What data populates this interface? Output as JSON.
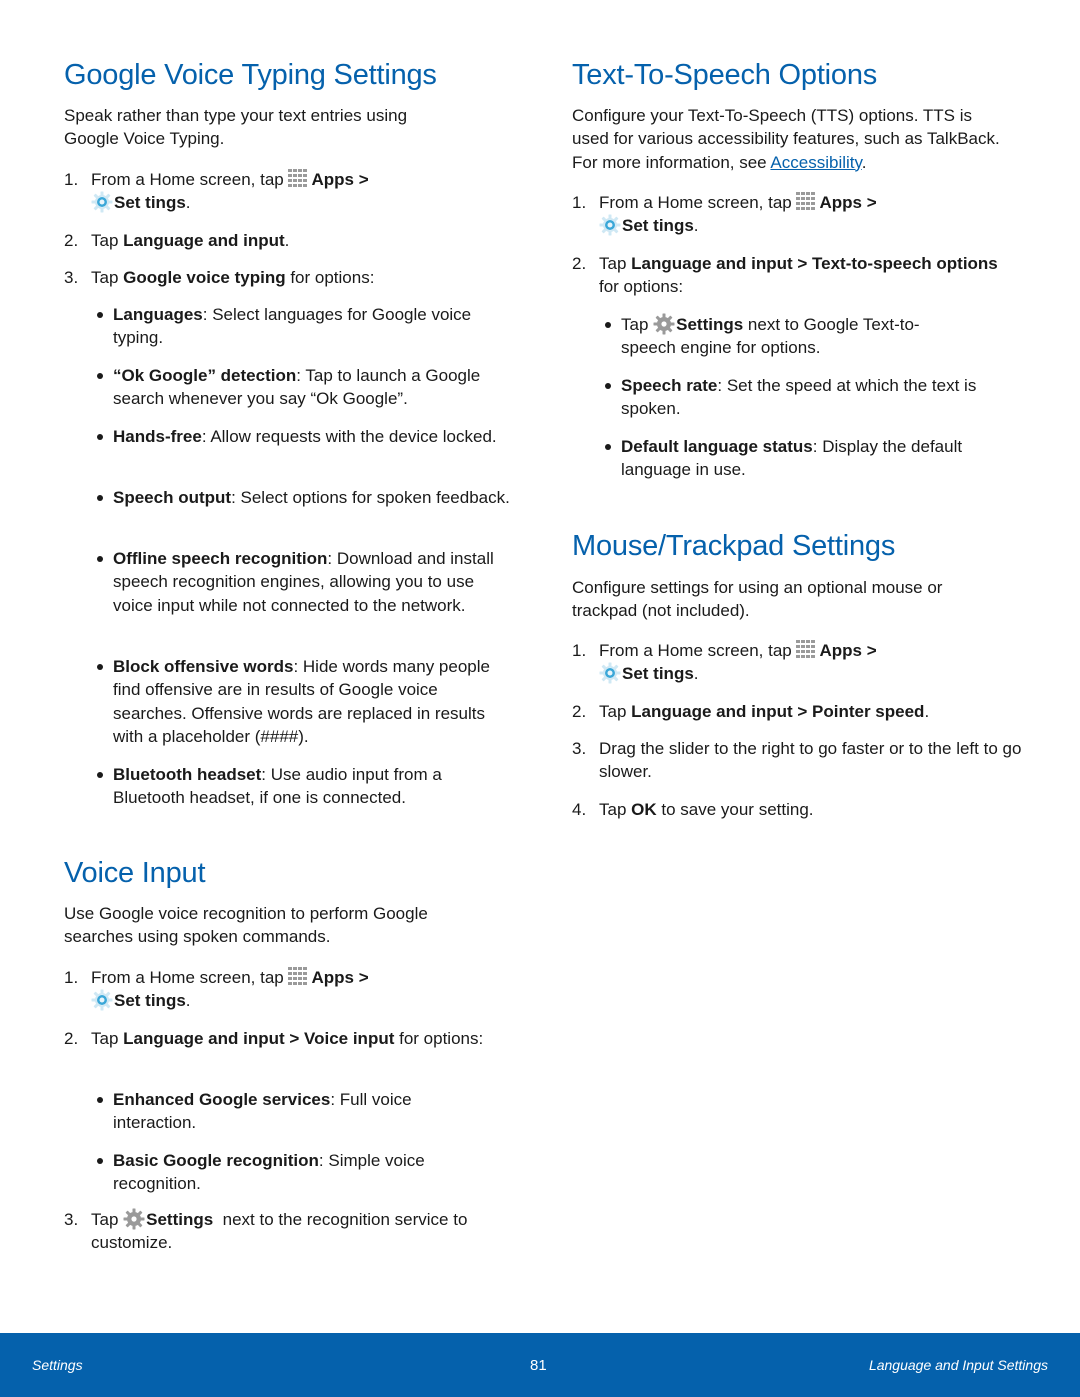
{
  "left": {
    "gvt": {
      "title": "Google Voice Typing Settings",
      "intro": "Speak rather than type your text entries using Google Voice Typing.",
      "step1": {
        "num": "1.",
        "pre": "From a Home screen, tap ",
        "apps": "Apps",
        "sep": " >",
        "settings": "Set tings",
        "end": "."
      },
      "step2": {
        "num": "2.",
        "pre": "Tap ",
        "bold": "Language and input",
        "end": "."
      },
      "step3": {
        "num": "3.",
        "pre": "Tap ",
        "bold": "Google voice typing",
        "end": " for options:"
      },
      "bullets": [
        {
          "term": "Languages",
          "text": ": Select languages for Google voice typing."
        },
        {
          "term": "“Ok Google” detection",
          "text": ": Tap to launch a Google search whenever you say “Ok Google”."
        },
        {
          "term": "Hands-free",
          "text": ": Allow requests with the device locked."
        },
        {
          "term": "Speech output",
          "text": ": Select options for spoken feedback."
        },
        {
          "term": "Offline speech recognition",
          "text": ": Download and install speech recognition engines, allowing you to use voice input while not connected to the network."
        },
        {
          "term": "Block offensive words",
          "text": ": Hide words many people find offensive are in results of Google voice searches. Offensive words are replaced in results with a placeholder (####)."
        },
        {
          "term": "Bluetooth headset",
          "text": ": Use audio input from a Bluetooth headset, if one is connected."
        }
      ]
    },
    "voice": {
      "title": "Voice Input",
      "intro": "Use Google voice recognition to perform Google searches using spoken commands.",
      "step1": {
        "num": "1.",
        "pre": "From a Home screen, tap ",
        "apps": "Apps",
        "sep": " >",
        "settings": "Set tings",
        "end": "."
      },
      "step2": {
        "num": "2.",
        "pre": "Tap ",
        "bold1": "Language and input",
        "mid": " > ",
        "bold2": "Voice input",
        "end": " for options:"
      },
      "bullets": [
        {
          "term": "Enhanced Google services",
          "text": ": Full voice interaction."
        },
        {
          "term": "Basic Google recognition",
          "text": ": Simple voice recognition."
        }
      ],
      "step3": {
        "num": "3.",
        "pre": "Tap ",
        "bold": "Settings",
        "end": "  next to the recognition service to customize."
      }
    }
  },
  "right": {
    "tts": {
      "title": "Text-To-Speech Options",
      "intro": "Configure your Text-To-Speech (TTS) options. TTS is used for various accessibility features, such as TalkBack. For more information, see ",
      "link": "Accessibility",
      "intro_end": ".",
      "step1": {
        "num": "1.",
        "pre": "From a Home screen, tap ",
        "apps": "Apps",
        "sep": " >",
        "settings": "Set tings",
        "end": "."
      },
      "step2": {
        "num": "2.",
        "pre": "Tap ",
        "bold1": "Language and input",
        "mid": " > ",
        "bold2": "Text-to-speech options",
        "end": " for options:"
      },
      "bullet_settings": {
        "pre": "Tap ",
        "bold": "Settings",
        "end": " next to Google Text-to-speech engine for options."
      },
      "bullets": [
        {
          "term": "Speech rate",
          "text": ": Set the speed at which the text is spoken."
        },
        {
          "term": "Default language status",
          "text": ": Display the default language in use."
        }
      ]
    },
    "mouse": {
      "title": "Mouse/Trackpad Settings",
      "intro": "Configure settings for using an optional mouse or trackpad (not included).",
      "step1": {
        "num": "1.",
        "pre": "From a Home screen, tap ",
        "apps": "Apps",
        "sep": " >",
        "settings": "Set tings",
        "end": "."
      },
      "step2": {
        "num": "2.",
        "pre": "Tap ",
        "bold1": "Language and input",
        "mid": " > ",
        "bold2": "Pointer speed",
        "end": "."
      },
      "step3": {
        "num": "3.",
        "text": "Drag the slider to the right to go faster or to the left to go slower."
      },
      "step4": {
        "num": "4.",
        "pre": "Tap ",
        "bold": "OK",
        "end": " to save your setting."
      }
    }
  },
  "footer": {
    "left": "Settings",
    "page": "81",
    "right": "Language and Input Settings",
    "bg_color": "#0561ac"
  },
  "colors": {
    "heading": "#0561ac",
    "link": "#0561ac",
    "settings_icon_blue": "#3aa7d8",
    "icon_gray": "#9a9a9a"
  }
}
